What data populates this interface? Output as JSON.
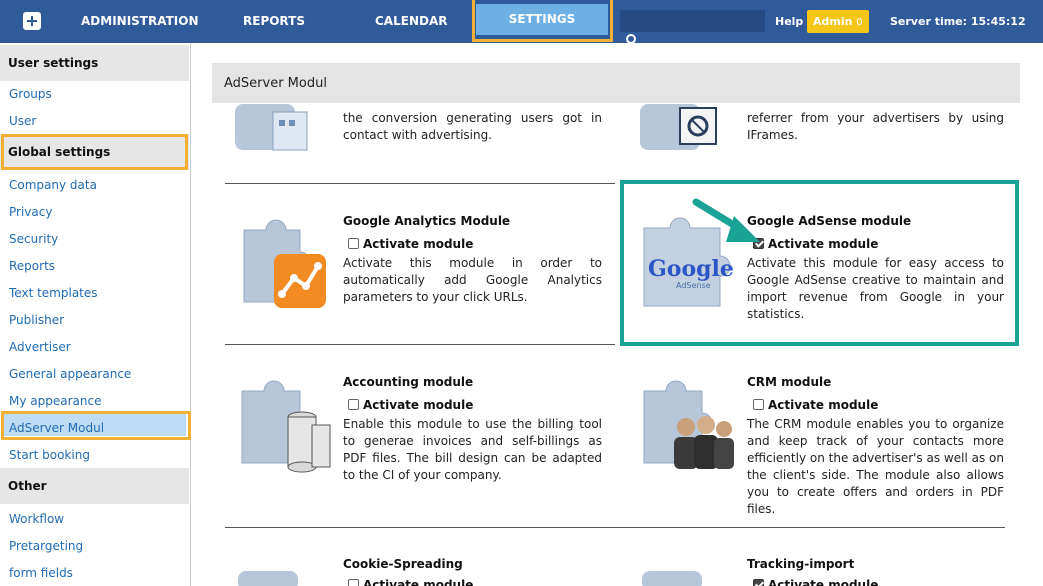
{
  "topbar": {
    "nav": [
      "ADMINISTRATION",
      "REPORTS",
      "CALENDAR"
    ],
    "active_nav": "SETTINGS",
    "help": "Help",
    "admin_label": "Admin",
    "admin_count": "0",
    "server_time": "Server time: 15:45:12"
  },
  "sidebar": {
    "sections": [
      "User settings",
      "Global settings",
      "Other"
    ],
    "user_items": [
      "Groups",
      "User"
    ],
    "global_items": [
      "Company data",
      "Privacy",
      "Security",
      "Reports",
      "Text templates",
      "Publisher",
      "Advertiser",
      "General appearance",
      "My appearance",
      "AdServer Modul",
      "Start booking"
    ],
    "other_items": [
      "Workflow",
      "Pretargeting",
      "form fields"
    ]
  },
  "main": {
    "header": "AdServer Modul",
    "partial_left": "the conversion generating users got in contact with advertising.",
    "partial_right": "referrer from your advertisers by using IFrames.",
    "activate_label": "Activate module",
    "modules": [
      {
        "title": "Google Analytics Module",
        "checked": false,
        "desc": "Activate this module in order to automatically add Google Analytics parameters to your click URLs."
      },
      {
        "title": "Google AdSense module",
        "checked": true,
        "desc": "Activate this module for easy access to Google AdSense creative to maintain and import revenue from Google in your statistics."
      },
      {
        "title": "Accounting module",
        "checked": false,
        "desc": "Enable this module to use the billing tool to generae invoices and self-billings as PDF files. The bill design can be adapted to the CI of your company."
      },
      {
        "title": "CRM module",
        "checked": false,
        "desc": "The CRM module enables you to organize and keep track of your contacts more efficiently on the advertiser's as well as on the client's side. The module also allows you to create offers and orders in PDF files."
      },
      {
        "title": "Cookie-Spreading",
        "checked": false,
        "desc": ""
      },
      {
        "title": "Tracking-import",
        "checked": true,
        "desc": ""
      }
    ],
    "google_logo": "Google",
    "adsense_logo": "AdSense"
  },
  "colors": {
    "topbar": "#2f5b9a",
    "settings_tab": "#6fb0e4",
    "highlight_orange": "#f2b134",
    "highlight_teal": "#1aa394",
    "admin_badge": "#f5c518",
    "link": "#1f6bb3"
  }
}
